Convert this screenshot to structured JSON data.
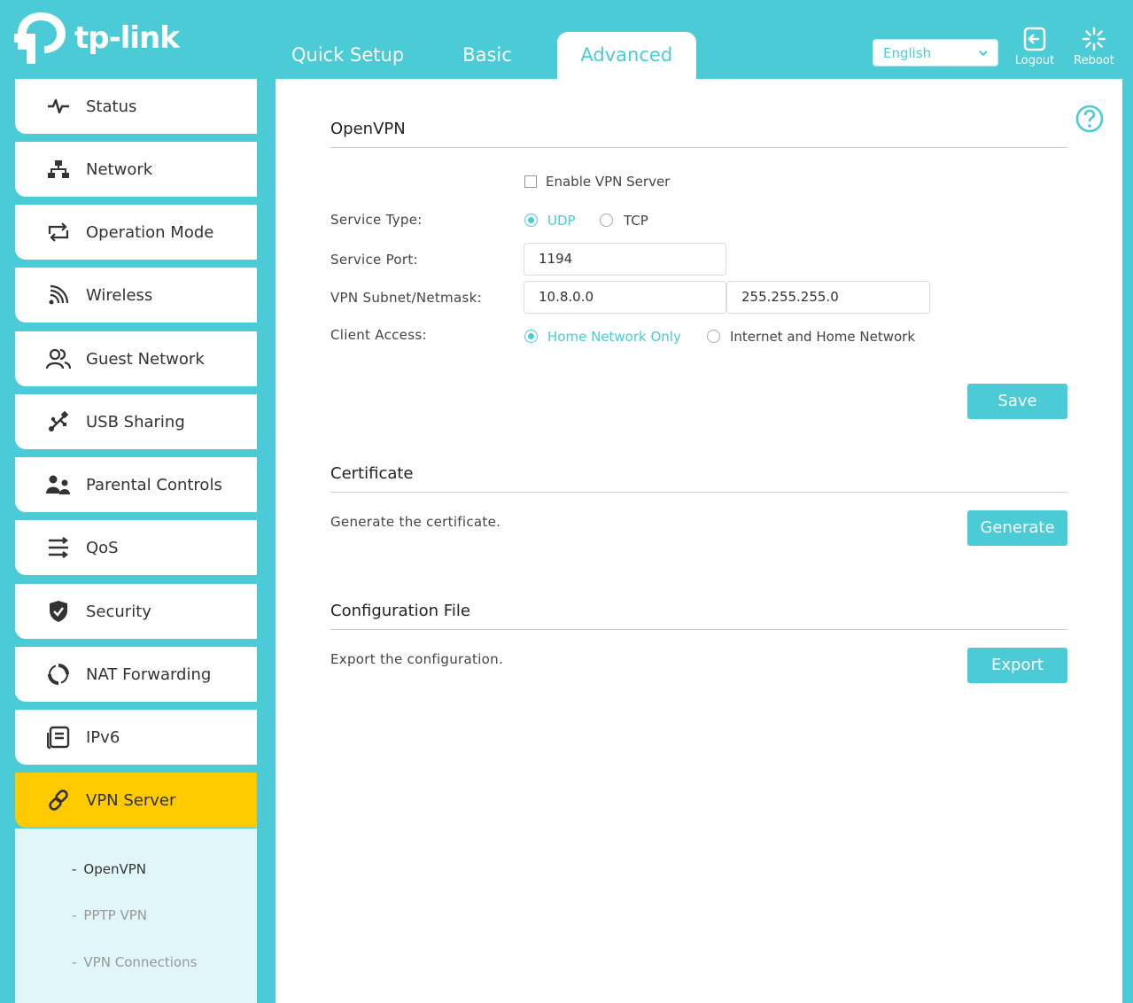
{
  "header": {
    "brand": "tp-link",
    "tabs": [
      {
        "label": "Quick Setup",
        "active": false
      },
      {
        "label": "Basic",
        "active": false
      },
      {
        "label": "Advanced",
        "active": true
      }
    ],
    "language": {
      "selected": "English"
    },
    "logout_label": "Logout",
    "reboot_label": "Reboot"
  },
  "sidebar": {
    "items": [
      {
        "label": "Status",
        "icon": "pulse-icon"
      },
      {
        "label": "Network",
        "icon": "network-icon"
      },
      {
        "label": "Operation Mode",
        "icon": "operation-mode-icon"
      },
      {
        "label": "Wireless",
        "icon": "wireless-icon"
      },
      {
        "label": "Guest Network",
        "icon": "guest-users-icon"
      },
      {
        "label": "USB Sharing",
        "icon": "usb-icon"
      },
      {
        "label": "Parental Controls",
        "icon": "parental-icon"
      },
      {
        "label": "QoS",
        "icon": "qos-icon"
      },
      {
        "label": "Security",
        "icon": "shield-icon"
      },
      {
        "label": "NAT Forwarding",
        "icon": "nat-icon"
      },
      {
        "label": "IPv6",
        "icon": "ipv6-icon"
      },
      {
        "label": "VPN Server",
        "icon": "link-icon",
        "active": true
      }
    ],
    "submenu": [
      {
        "label": "OpenVPN",
        "current": true
      },
      {
        "label": "PPTP VPN",
        "current": false
      },
      {
        "label": "VPN Connections",
        "current": false
      }
    ]
  },
  "openvpn": {
    "title": "OpenVPN",
    "enable_label": "Enable VPN Server",
    "enabled": false,
    "service_type_label": "Service Type:",
    "service_type_options": [
      "UDP",
      "TCP"
    ],
    "service_type_selected": "UDP",
    "service_port_label": "Service Port:",
    "service_port_value": "1194",
    "subnet_label": "VPN Subnet/Netmask:",
    "subnet_value": "10.8.0.0",
    "netmask_value": "255.255.255.0",
    "client_access_label": "Client Access:",
    "client_access_options": [
      "Home Network Only",
      "Internet and Home Network"
    ],
    "client_access_selected": "Home Network Only",
    "save_label": "Save"
  },
  "certificate": {
    "title": "Certificate",
    "description": "Generate the certificate.",
    "button_label": "Generate"
  },
  "config_file": {
    "title": "Configuration File",
    "description": "Export the configuration.",
    "button_label": "Export"
  },
  "colors": {
    "accent": "#4acbd6",
    "active_nav": "#ffca00",
    "submenu_bg": "#e0f6f8"
  }
}
